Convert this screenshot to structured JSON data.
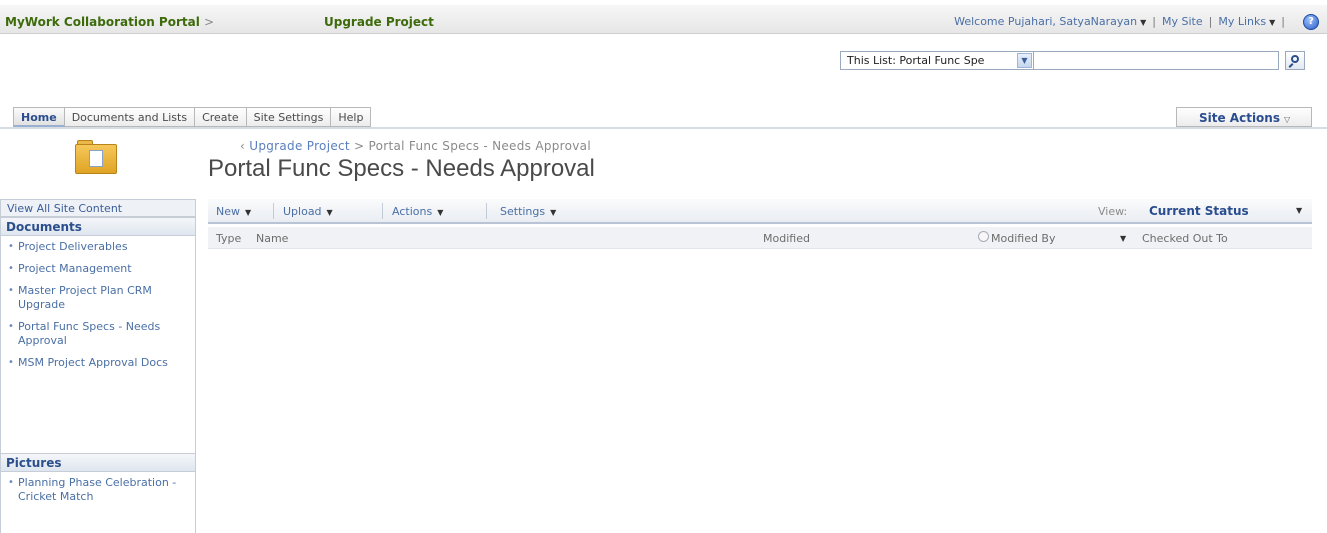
{
  "topbar": {
    "portal": "MyWork Collaboration Portal",
    "separator": ">",
    "project": "Upgrade Project",
    "welcome": "Welcome Pujahari, SatyaNarayan",
    "my_site": "My Site",
    "my_links": "My Links",
    "pipe": "|",
    "help_glyph": "?"
  },
  "search": {
    "scope": "This List: Portal Func Spe",
    "query": "",
    "scope_arrow": "▼"
  },
  "tabs": [
    {
      "label": "Home",
      "active": true
    },
    {
      "label": "Documents and Lists"
    },
    {
      "label": "Create"
    },
    {
      "label": "Site Settings"
    },
    {
      "label": "Help"
    }
  ],
  "site_actions": {
    "label": "Site Actions",
    "caret": "▽"
  },
  "page": {
    "crumb_lead": "‹",
    "crumb_link": "Upgrade Project",
    "crumb_rest": "> Portal Func Specs - Needs Approval",
    "title": "Portal Func Specs - Needs Approval"
  },
  "quicklaunch": {
    "view_all": "View All Site Content",
    "sections": [
      {
        "title": "Documents",
        "items": [
          "Project Deliverables",
          "Project Management",
          "Master Project Plan CRM Upgrade",
          "Portal Func Specs - Needs Approval",
          "MSM Project Approval Docs"
        ]
      },
      {
        "title": "Pictures",
        "items": [
          "Planning Phase Celebration - Cricket Match"
        ]
      }
    ]
  },
  "toolbar": {
    "new": "New",
    "upload": "Upload",
    "actions": "Actions",
    "settings": "Settings",
    "view_label": "View:",
    "view_value": "Current Status",
    "caret": "▼"
  },
  "columns": {
    "type": "Type",
    "name": "Name",
    "modified": "Modified",
    "modified_by": "Modified By",
    "checked_out_to": "Checked Out To"
  },
  "colors": {
    "brand_green": "#3d6a0a",
    "link_blue": "#4a6fa5",
    "accent_blue": "#2a4d8f"
  }
}
